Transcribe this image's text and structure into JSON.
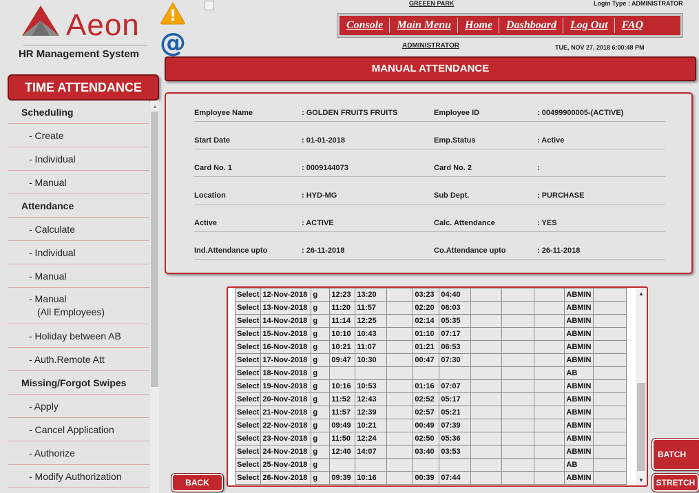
{
  "app": {
    "brand": "Aeon",
    "subtitle": "HR Management System",
    "module_title": "TIME ATTENDANCE"
  },
  "menu": [
    {
      "label": "Scheduling",
      "type": "head"
    },
    {
      "label": "- Create",
      "type": "item"
    },
    {
      "label": "- Individual",
      "type": "item"
    },
    {
      "label": "- Manual",
      "type": "item"
    },
    {
      "label": "Attendance",
      "type": "head"
    },
    {
      "label": "- Calculate",
      "type": "item"
    },
    {
      "label": "- Individual",
      "type": "item"
    },
    {
      "label": "- Manual",
      "type": "item"
    },
    {
      "label": "- Manual",
      "label2": "(All Employees)",
      "type": "tall"
    },
    {
      "label": "- Holiday between AB",
      "type": "item"
    },
    {
      "label": "- Auth.Remote Att",
      "type": "item"
    },
    {
      "label": "Missing/Forgot Swipes",
      "type": "head"
    },
    {
      "label": "- Apply",
      "type": "item"
    },
    {
      "label": "- Cancel Application",
      "type": "item"
    },
    {
      "label": "- Authorize",
      "type": "item"
    },
    {
      "label": "- Modify Authorization",
      "type": "item"
    }
  ],
  "header": {
    "branch": "GREEEN PARK",
    "login_type": "Login Type : ADMINISTRATOR",
    "user": "ADMINISTRATOR",
    "datetime": "TUE, NOV 27, 2018 6:00:48 PM",
    "nav": [
      "Console",
      "Main Menu",
      "Home",
      "Dashboard",
      "Log Out",
      "FAQ"
    ]
  },
  "page_title": "MANUAL ATTENDANCE",
  "employee": [
    [
      "Employee Name",
      ":  GOLDEN FRUITS  FRUITS",
      "Employee ID",
      ":  00499900005-(ACTIVE)"
    ],
    [
      "Start Date",
      ":  01-01-2018",
      "Emp.Status",
      ":  Active"
    ],
    [
      "Card No. 1",
      ":  0009144073",
      "Card No. 2",
      ":"
    ],
    [
      "Location",
      ":  HYD-MG",
      "Sub Dept.",
      ":  PURCHASE"
    ],
    [
      "Active",
      ":  ACTIVE",
      "Calc. Attendance",
      ":  YES"
    ],
    [
      "Ind.Attendance upto",
      ":  26-11-2018",
      "Co.Attendance upto",
      ":  26-11-2018"
    ]
  ],
  "attendance_rows": [
    [
      "Select",
      "12-Nov-2018",
      "g",
      "12:23",
      "13:20",
      "",
      "03:23",
      "04:40",
      "",
      "",
      "",
      "ABMIN",
      "",
      ""
    ],
    [
      "Select",
      "13-Nov-2018",
      "g",
      "11:20",
      "11:57",
      "",
      "02:20",
      "06:03",
      "",
      "",
      "",
      "ABMIN",
      "",
      ""
    ],
    [
      "Select",
      "14-Nov-2018",
      "g",
      "11:14",
      "12:25",
      "",
      "02:14",
      "05:35",
      "",
      "",
      "",
      "ABMIN",
      "",
      ""
    ],
    [
      "Select",
      "15-Nov-2018",
      "g",
      "10:10",
      "10:43",
      "",
      "01:10",
      "07:17",
      "",
      "",
      "",
      "ABMIN",
      "",
      ""
    ],
    [
      "Select",
      "16-Nov-2018",
      "g",
      "10:21",
      "11:07",
      "",
      "01:21",
      "06:53",
      "",
      "",
      "",
      "ABMIN",
      "",
      ""
    ],
    [
      "Select",
      "17-Nov-2018",
      "g",
      "09:47",
      "10:30",
      "",
      "00:47",
      "07:30",
      "",
      "",
      "",
      "ABMIN",
      "",
      ""
    ],
    [
      "Select",
      "18-Nov-2018",
      "g",
      "",
      "",
      "",
      "",
      "",
      "",
      "",
      "",
      "AB",
      "",
      ""
    ],
    [
      "Select",
      "19-Nov-2018",
      "g",
      "10:16",
      "10:53",
      "",
      "01:16",
      "07:07",
      "",
      "",
      "",
      "ABMIN",
      "",
      ""
    ],
    [
      "Select",
      "20-Nov-2018",
      "g",
      "11:52",
      "12:43",
      "",
      "02:52",
      "05:17",
      "",
      "",
      "",
      "ABMIN",
      "",
      ""
    ],
    [
      "Select",
      "21-Nov-2018",
      "g",
      "11:57",
      "12:39",
      "",
      "02:57",
      "05:21",
      "",
      "",
      "",
      "ABMIN",
      "",
      ""
    ],
    [
      "Select",
      "22-Nov-2018",
      "g",
      "09:49",
      "10:21",
      "",
      "00:49",
      "07:39",
      "",
      "",
      "",
      "ABMIN",
      "",
      ""
    ],
    [
      "Select",
      "23-Nov-2018",
      "g",
      "11:50",
      "12:24",
      "",
      "02:50",
      "05:36",
      "",
      "",
      "",
      "ABMIN",
      "",
      ""
    ],
    [
      "Select",
      "24-Nov-2018",
      "g",
      "12:40",
      "14:07",
      "",
      "03:40",
      "03:53",
      "",
      "",
      "",
      "ABMIN",
      "",
      ""
    ],
    [
      "Select",
      "25-Nov-2018",
      "g",
      "",
      "",
      "",
      "",
      "",
      "",
      "",
      "",
      "AB",
      "",
      ""
    ],
    [
      "Select",
      "26-Nov-2018",
      "g",
      "09:39",
      "10:16",
      "",
      "00:39",
      "07:44",
      "",
      "",
      "",
      "ABMIN",
      "",
      ""
    ]
  ],
  "buttons": {
    "back": "BACK",
    "batch_update": "BATCH UPDATE",
    "stretch": "STRETCH"
  },
  "icons": {
    "warning": "warning-icon",
    "email": "@",
    "logo": "aeon-logo-icon"
  },
  "colors": {
    "accent": "#c0282d",
    "background": "#e4e4e4"
  }
}
